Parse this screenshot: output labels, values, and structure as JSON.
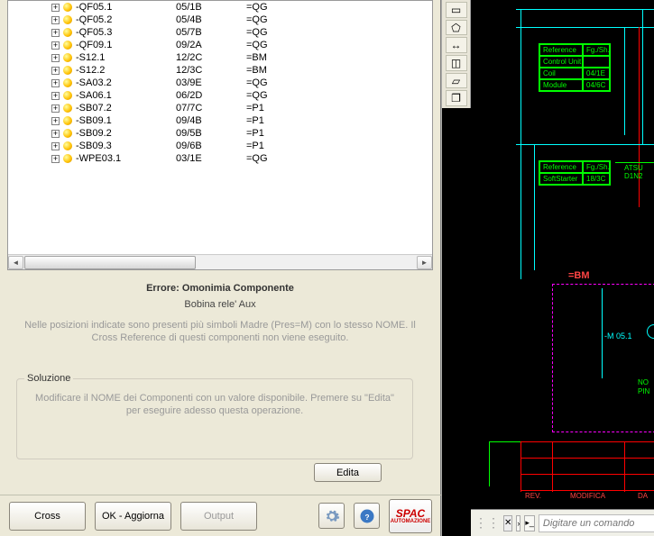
{
  "tree_rows": [
    {
      "name": "-QF05.1",
      "pos": "05/1B",
      "eq": "=QG"
    },
    {
      "name": "-QF05.2",
      "pos": "05/4B",
      "eq": "=QG"
    },
    {
      "name": "-QF05.3",
      "pos": "05/7B",
      "eq": "=QG"
    },
    {
      "name": "-QF09.1",
      "pos": "09/2A",
      "eq": "=QG"
    },
    {
      "name": "-S12.1",
      "pos": "12/2C",
      "eq": "=BM"
    },
    {
      "name": "-S12.2",
      "pos": "12/3C",
      "eq": "=BM"
    },
    {
      "name": "-SA03.2",
      "pos": "03/9E",
      "eq": "=QG"
    },
    {
      "name": "-SA06.1",
      "pos": "06/2D",
      "eq": "=QG"
    },
    {
      "name": "-SB07.2",
      "pos": "07/7C",
      "eq": "=P1"
    },
    {
      "name": "-SB09.1",
      "pos": "09/4B",
      "eq": "=P1"
    },
    {
      "name": "-SB09.2",
      "pos": "09/5B",
      "eq": "=P1"
    },
    {
      "name": "-SB09.3",
      "pos": "09/6B",
      "eq": "=P1"
    },
    {
      "name": "-WPE03.1",
      "pos": "03/1E",
      "eq": "=QG"
    }
  ],
  "error": {
    "title": "Errore: Omonimia Componente",
    "subtitle": "Bobina rele' Aux",
    "desc": "Nelle posizioni indicate sono presenti più simboli Madre (Pres=M) con lo stesso NOME. Il Cross Reference di questi componenti non viene eseguito."
  },
  "solution": {
    "legend": "Soluzione",
    "text": "Modificare il NOME dei Componenti con un valore disponibile. Premere su \"Edita\" per eseguire adesso questa operazione.",
    "edit_btn": "Edita"
  },
  "bottom": {
    "cross": "Cross",
    "ok": "OK - Aggiorna",
    "output": "Output"
  },
  "logo": {
    "t1": "SPAC",
    "t2": "AUTOMAZIONE"
  },
  "cad": {
    "ref_tables": [
      {
        "header": [
          "Reference",
          "Fg./Sh."
        ],
        "rows": [
          [
            "Control Unit",
            ""
          ],
          [
            "Coil",
            "04/1E"
          ],
          [
            "Module",
            "04/6C"
          ]
        ]
      },
      {
        "header": [
          "Reference",
          "Fg./Sh."
        ],
        "rows": [
          [
            "SoftStarter",
            "18/3C"
          ]
        ]
      }
    ],
    "big_label": "=BM",
    "small_label": "-M 05.1",
    "atsu": "ATSU D1N2",
    "note_no": "NO",
    "note_pin": "PIN",
    "tbl_footer": [
      "REV.",
      "MODIFICA",
      "DA"
    ],
    "cmd_placeholder": "Digitare un comando"
  }
}
